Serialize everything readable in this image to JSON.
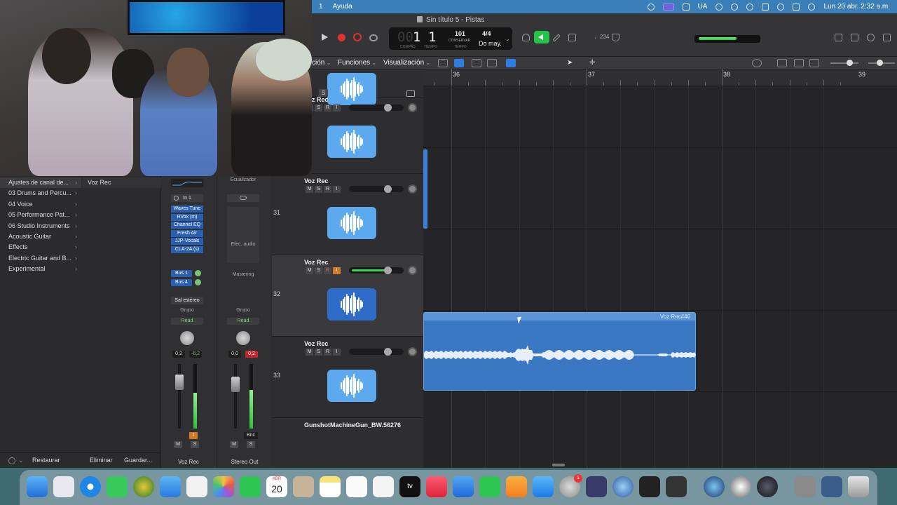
{
  "menubar": {
    "items": [
      "1",
      "Ayuda"
    ],
    "lang": "UA",
    "clock": "Lun 20 abr.  2:32 a.m."
  },
  "window": {
    "title": "Sin título 5 - Pistas"
  },
  "lcd": {
    "bar_dim": "00",
    "bar": "1",
    "beat": "1",
    "bar_label": "COMPÁS",
    "beat_label": "TIEMPO",
    "tempo": "101",
    "tempo_sub": "CONSERVAR",
    "tempo_label": "TEMPO",
    "sig": "4/4",
    "key": "Do may."
  },
  "bpm_shortcut": "♩234",
  "trackbar": {
    "menu_edit": "ción",
    "menu_functions": "Funciones",
    "menu_view": "Visualización"
  },
  "ruler": {
    "bars": [
      "36",
      "37",
      "38",
      "39"
    ]
  },
  "library": {
    "left": [
      "Ajustes de canal de...",
      "03 Drums and Percu...",
      "04 Voice",
      "05 Performance Pat...",
      "06 Studio Instruments",
      "Acoustic Guitar",
      "Effects",
      "Electric Guitar and B...",
      "Experimental"
    ],
    "right": [
      "Voz Rec"
    ],
    "footer": {
      "restore": "Restaurar",
      "delete": "Eliminar",
      "save": "Guardar..."
    }
  },
  "strips": {
    "voz": {
      "name": "Voz Rec",
      "input": "In 1",
      "plugins": [
        "Waves Tune",
        "RVox (m)",
        "Channel EQ",
        "Fresh Air",
        "JJP-Vocals",
        "CLA-2A (s)"
      ],
      "sends": [
        "Bus 1",
        "Bus 4"
      ],
      "output": "Sal estéreo",
      "group": "Grupo",
      "automation": "Read",
      "pan_val": "0,2",
      "peak": "-6,2",
      "meter_level": 0.55
    },
    "stereo": {
      "name": "Stereo Out",
      "eq": "Ecualizador",
      "effects": "Efec. audio",
      "mastering": "Mastering",
      "group": "Grupo",
      "automation": "Read",
      "pan_val": "0,0",
      "peak": "0,2",
      "bounce": "Bnc",
      "meter_level": 0.6
    }
  },
  "tracks": [
    {
      "num": "",
      "name": "",
      "selected": false
    },
    {
      "num": "",
      "name": "Voz Rec",
      "selected": false
    },
    {
      "num": "31",
      "name": "Voz Rec",
      "selected": false
    },
    {
      "num": "32",
      "name": "Voz Rec",
      "selected": true
    },
    {
      "num": "33",
      "name": "Voz Rec",
      "selected": false
    },
    {
      "num": "",
      "name": "GunshotMachineGun_BW.56276",
      "selected": false
    }
  ],
  "region": {
    "name": "Voz Rec#46"
  },
  "dock": {
    "calendar_month": "ABR",
    "calendar_day": "20",
    "badge": "1",
    "tv_label": "tv"
  },
  "colors": {
    "menubar": "#3b7fb8",
    "region": "#3a78c4",
    "track_icon": "#5da9ef",
    "record": "#e03030",
    "meter": "#3ed64e"
  }
}
